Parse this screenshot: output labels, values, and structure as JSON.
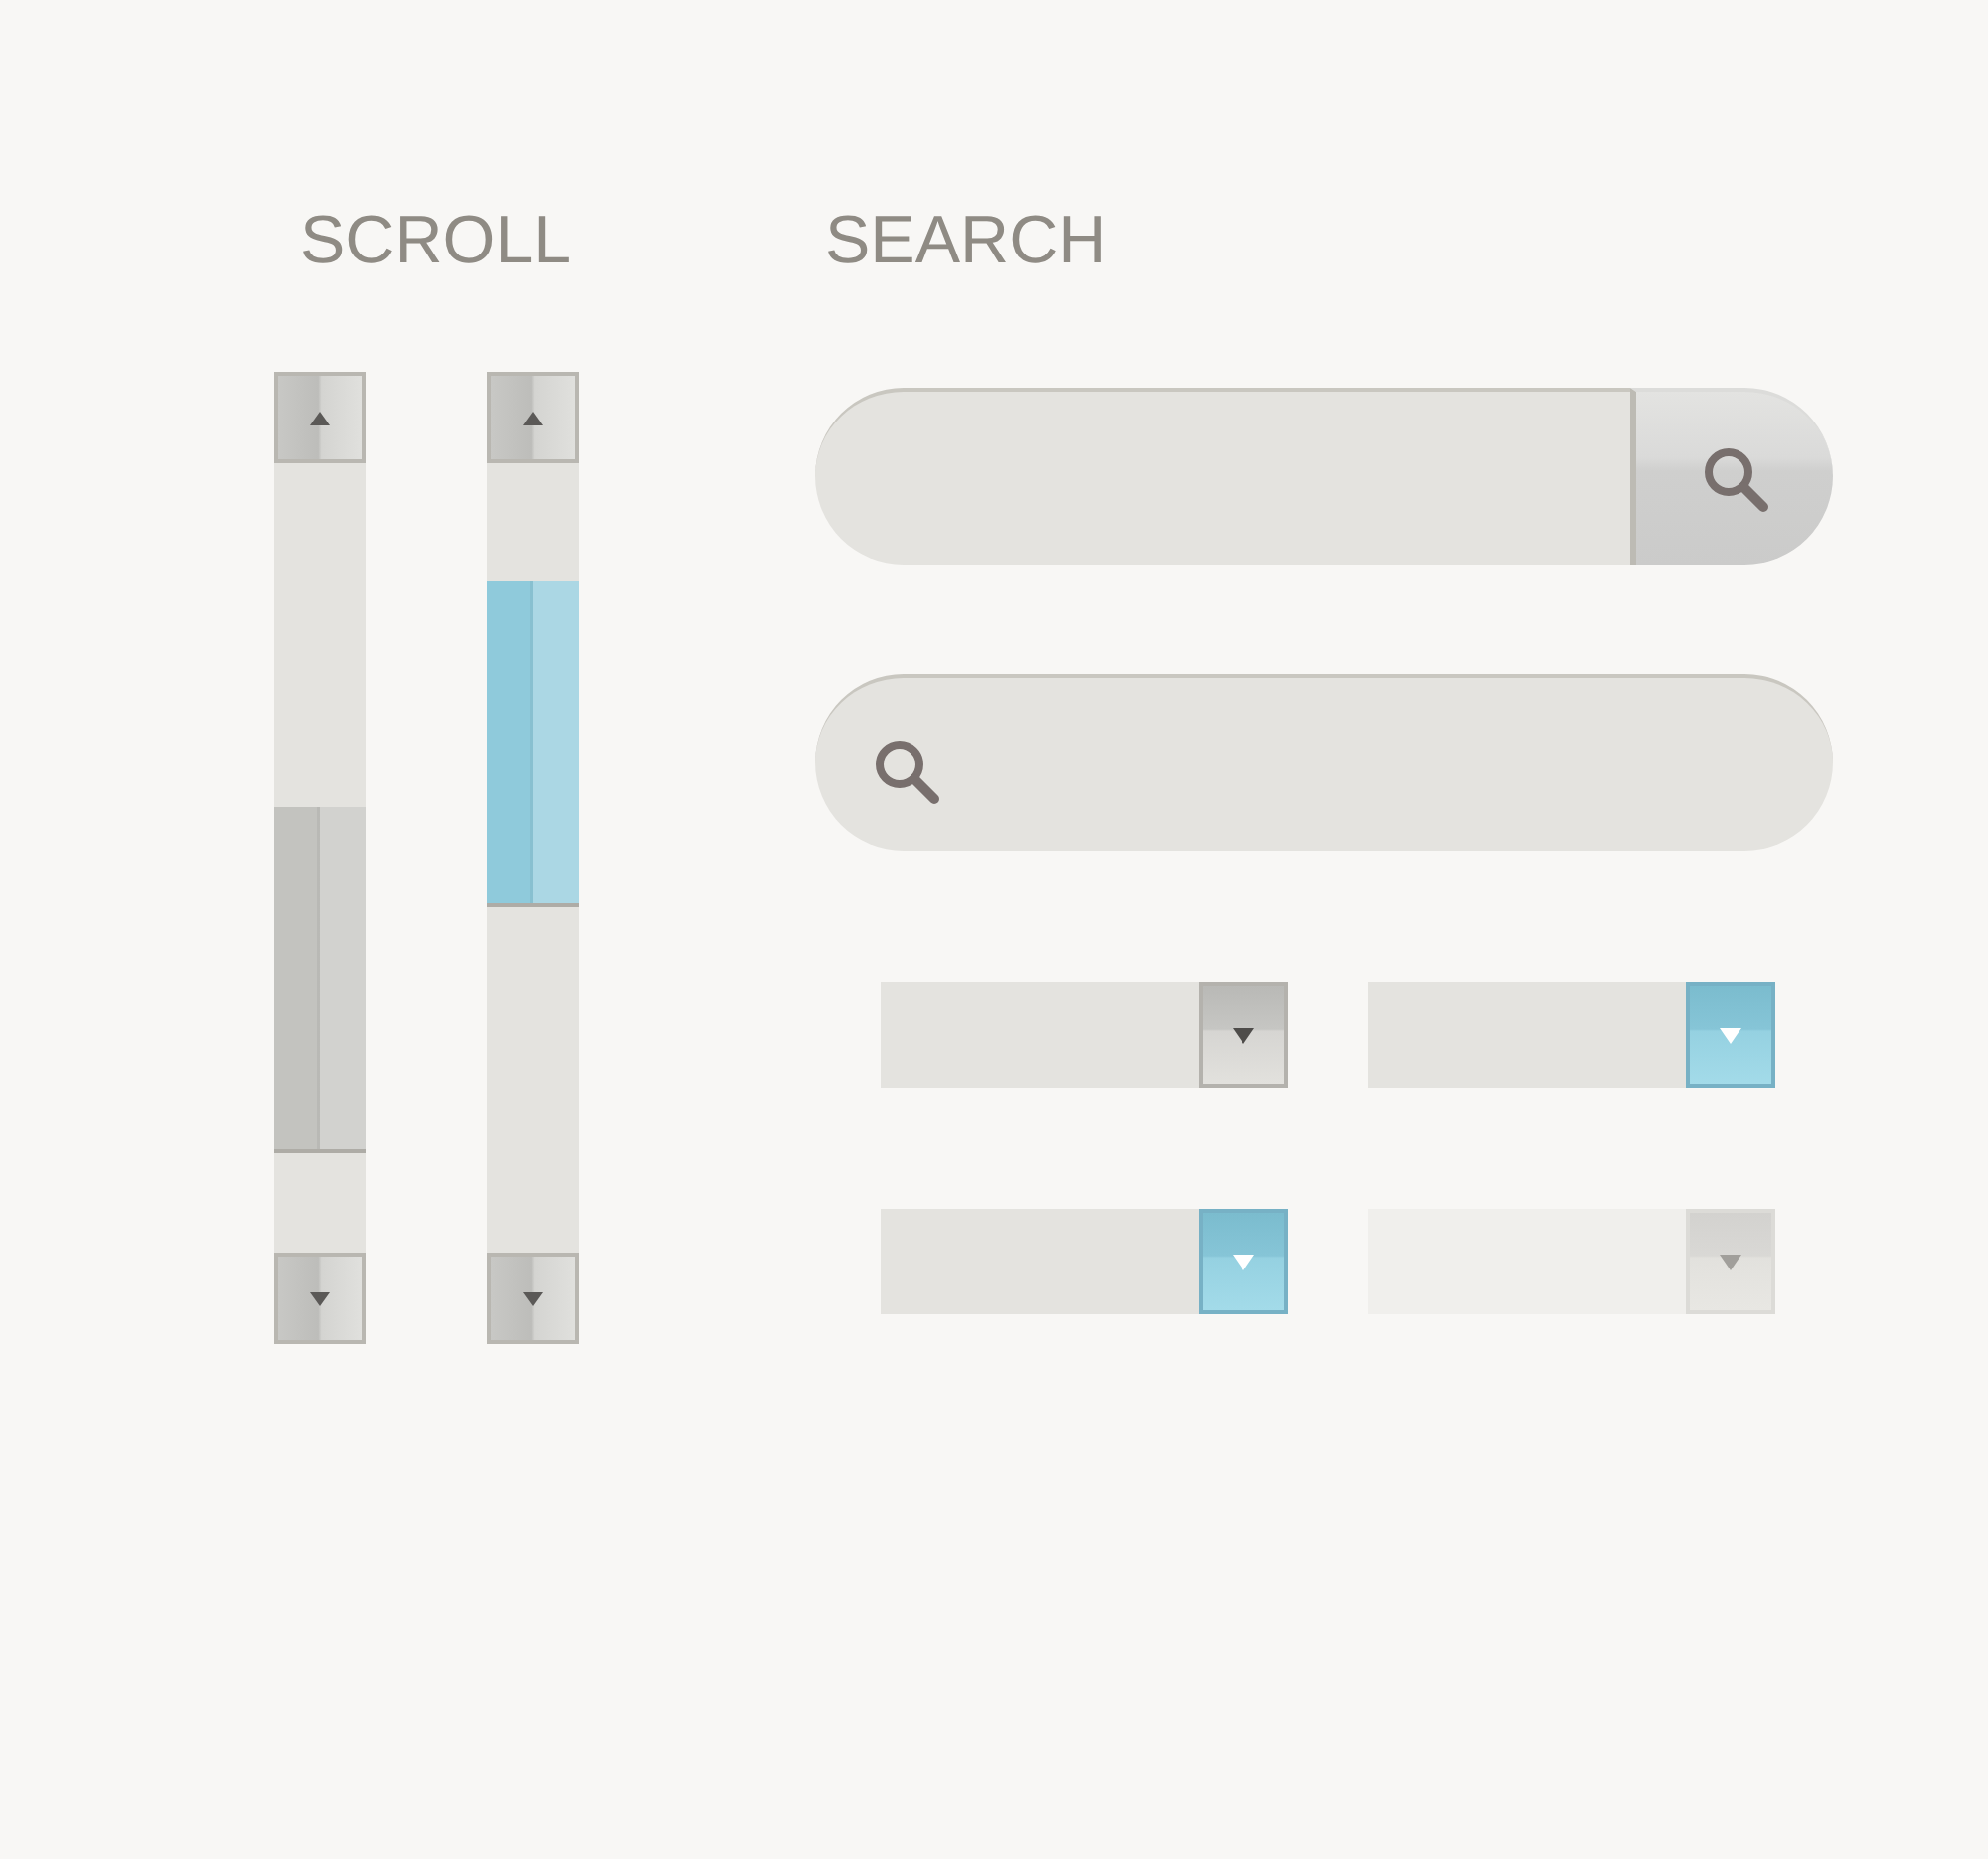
{
  "scroll_section": {
    "title": "SCROLL",
    "scrollbars": [
      {
        "color": "#c3c3bf"
      },
      {
        "color": "#8fcadb"
      }
    ]
  },
  "search_section": {
    "title": "SEARCH",
    "search_bars": [
      {
        "kind": "button"
      },
      {
        "kind": "icon"
      }
    ],
    "dropdowns": [
      {
        "active": false,
        "disabled": false
      },
      {
        "active": true,
        "disabled": false
      },
      {
        "active": true,
        "disabled": false
      },
      {
        "active": false,
        "disabled": true
      }
    ]
  }
}
